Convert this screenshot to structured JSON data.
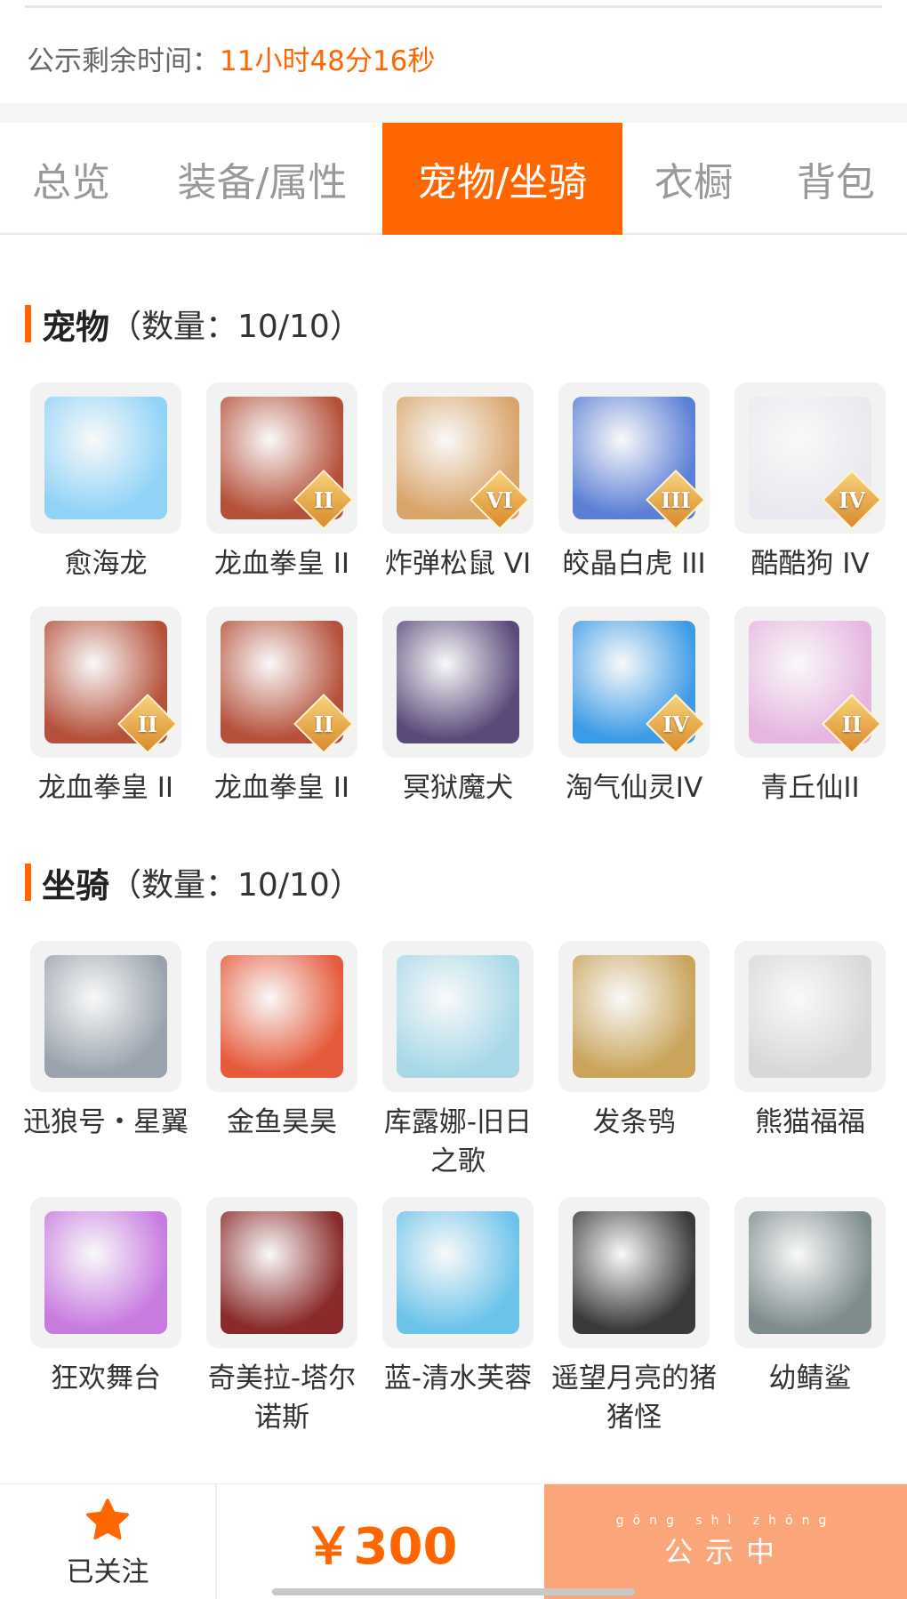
{
  "notice": {
    "label": "公示剩余时间：",
    "value": "11小时48分16秒"
  },
  "tabs": [
    {
      "label": "总览",
      "active": false
    },
    {
      "label": "装备/属性",
      "active": false
    },
    {
      "label": "宠物/坐骑",
      "active": true
    },
    {
      "label": "衣橱",
      "active": false
    },
    {
      "label": "背包",
      "active": false
    }
  ],
  "pets": {
    "title": "宠物",
    "count": "（数量：10/10）",
    "items": [
      {
        "name": "愈海龙",
        "tier": "",
        "color": "#8fd3f7"
      },
      {
        "name": "龙血拳皇 II",
        "tier": "II",
        "color": "#b5503a"
      },
      {
        "name": "炸弹松鼠 VI",
        "tier": "VI",
        "color": "#d9a46a"
      },
      {
        "name": "皎晶白虎 III",
        "tier": "III",
        "color": "#5b7fd6"
      },
      {
        "name": "酷酷狗 IV",
        "tier": "IV",
        "color": "#e9e9ef"
      },
      {
        "name": "龙血拳皇 II",
        "tier": "II",
        "color": "#b5503a"
      },
      {
        "name": "龙血拳皇 II",
        "tier": "II",
        "color": "#b5503a"
      },
      {
        "name": "冥狱魔犬",
        "tier": "",
        "color": "#5a4a7a"
      },
      {
        "name": "淘气仙灵IV",
        "tier": "IV",
        "color": "#3c9be6"
      },
      {
        "name": "青丘仙II",
        "tier": "II",
        "color": "#e6b6e0"
      }
    ]
  },
  "mounts": {
    "title": "坐骑",
    "count": "（数量：10/10）",
    "items": [
      {
        "name": "迅狼号・星翼",
        "color": "#9aa3ad"
      },
      {
        "name": "金鱼昊昊",
        "color": "#e55a3a"
      },
      {
        "name": "库露娜-旧日之歌",
        "color": "#a8d8e8"
      },
      {
        "name": "发条鸮",
        "color": "#c9a45a"
      },
      {
        "name": "熊猫福福",
        "color": "#d8d8d8"
      },
      {
        "name": "狂欢舞台",
        "color": "#c77ae0"
      },
      {
        "name": "奇美拉-塔尔诺斯",
        "color": "#8a2a2a"
      },
      {
        "name": "蓝-清水芙蓉",
        "color": "#6cc3ea"
      },
      {
        "name": "遥望月亮的猪猪怪",
        "color": "#3a3a3a"
      },
      {
        "name": "幼鲭鲨",
        "color": "#7f8c8d"
      }
    ]
  },
  "footer": {
    "follow_label": "已关注",
    "price": "￥300",
    "status_pinyin": "gōng shì zhōng",
    "status_text": "公示中"
  }
}
